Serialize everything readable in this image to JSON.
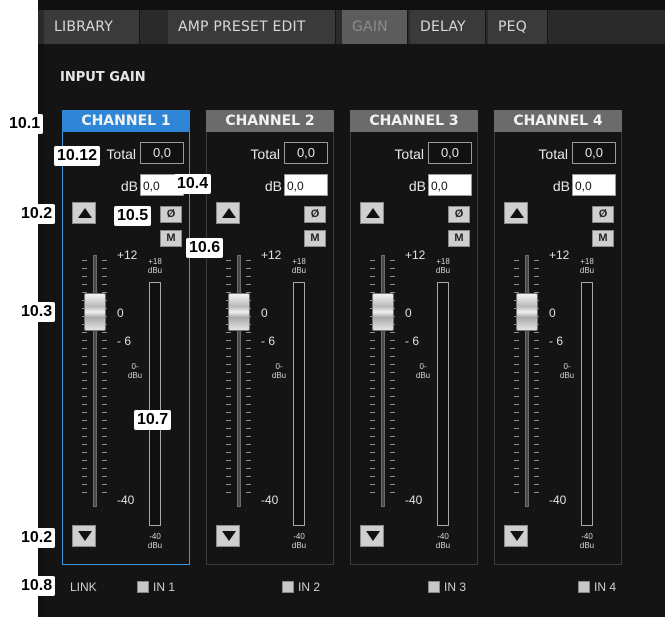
{
  "tabs": [
    "LIBRARY",
    "AMP PRESET EDIT",
    "GAIN",
    "DELAY",
    "PEQ"
  ],
  "section_title": "INPUT GAIN",
  "channels": [
    {
      "name": "CHANNEL 1",
      "total_label": "Total",
      "total": "0,0",
      "db_label": "dB",
      "db": "0,0",
      "phase": "Ø",
      "mute": "M"
    },
    {
      "name": "CHANNEL 2",
      "total_label": "Total",
      "total": "0,0",
      "db_label": "dB",
      "db": "0,0",
      "phase": "Ø",
      "mute": "M"
    },
    {
      "name": "CHANNEL 3",
      "total_label": "Total",
      "total": "0,0",
      "db_label": "dB",
      "db": "0,0",
      "phase": "Ø",
      "mute": "M"
    },
    {
      "name": "CHANNEL 4",
      "total_label": "Total",
      "total": "0,0",
      "db_label": "dB",
      "db": "0,0",
      "phase": "Ø",
      "mute": "M"
    }
  ],
  "fader_scale": {
    "top": "+12",
    "zero": "0",
    "minus6": "- 6",
    "bottom": "-40"
  },
  "meter_scale": {
    "top": "+18\ndBu",
    "mid": "0-\ndBu",
    "bottom": "-40\ndBu"
  },
  "link": {
    "label": "LINK",
    "inputs": [
      "IN 1",
      "IN 2",
      "IN 3",
      "IN 4"
    ]
  },
  "callouts": {
    "c10_1": "10.1",
    "c10_12": "10.12",
    "c10_4": "10.4",
    "c10_2a": "10.2",
    "c10_5": "10.5",
    "c10_6": "10.6",
    "c10_3": "10.3",
    "c10_7": "10.7",
    "c10_2b": "10.2",
    "c10_8": "10.8"
  }
}
